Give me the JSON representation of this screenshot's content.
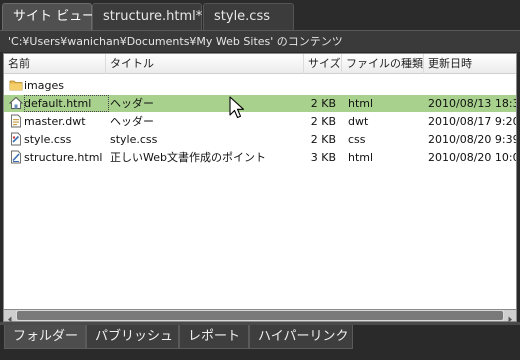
{
  "tabs": [
    {
      "label": "サイト ビュー"
    },
    {
      "label": "structure.html*"
    },
    {
      "label": "style.css"
    }
  ],
  "path": "'C:¥Users¥wanichan¥Documents¥My Web Sites' のコンテンツ",
  "columns": {
    "name": "名前",
    "title": "タイトル",
    "size": "サイズ",
    "type": "ファイルの種類",
    "date": "更新日時"
  },
  "rows": [
    {
      "icon": "folder-icon",
      "name": "images",
      "title": "",
      "size": "",
      "type": "",
      "date": ""
    },
    {
      "icon": "home-page-icon",
      "name": "default.html",
      "title": "ヘッダー",
      "size": "2 KB",
      "type": "html",
      "date": "2010/08/13 18:37"
    },
    {
      "icon": "template-file-icon",
      "name": "master.dwt",
      "title": "ヘッダー",
      "size": "2 KB",
      "type": "dwt",
      "date": "2010/08/17 9:20"
    },
    {
      "icon": "css-file-icon",
      "name": "style.css",
      "title": "style.css",
      "size": "2 KB",
      "type": "css",
      "date": "2010/08/20 9:39"
    },
    {
      "icon": "html-file-icon",
      "name": "structure.html",
      "title": "正しいWeb文書作成のポイント",
      "size": "3 KB",
      "type": "html",
      "date": "2010/08/20 10:00"
    }
  ],
  "bottom_tabs": [
    {
      "label": "フォルダー"
    },
    {
      "label": "パブリッシュ"
    },
    {
      "label": "レポート"
    },
    {
      "label": "ハイパーリンク"
    }
  ]
}
